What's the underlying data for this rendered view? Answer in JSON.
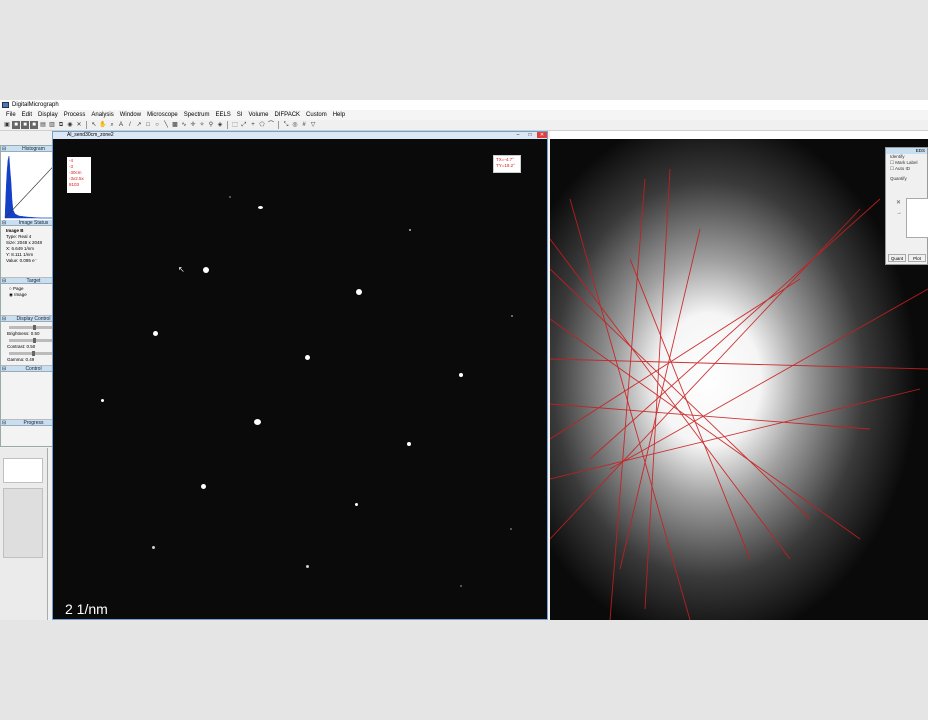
{
  "window": {
    "title": "DigitalMicrograph"
  },
  "menu": [
    "File",
    "Edit",
    "Display",
    "Process",
    "Analysis",
    "Window",
    "Microscope",
    "Spectrum",
    "EELS",
    "SI",
    "Volume",
    "DIFPACK",
    "Custom",
    "Help"
  ],
  "panels": {
    "histogram": "Histogram",
    "image_status": "Image Status",
    "status": {
      "name": "Image B",
      "type": "Type: Real 4",
      "size": "Size: 2048 x 2048",
      "x": "X:   6.649 1/nm",
      "y": "Y:   8.111 1/nm",
      "value": "Value: 0.095 e⁻"
    },
    "target": "Target",
    "target_page": "Page",
    "target_image": "Image",
    "display_control": "Display Control",
    "brightness": "Brightness: 0.50",
    "contrast": "Contrast: 0.50",
    "gamma": "Gamma: 0.49",
    "control": "Control",
    "progress": "Progress"
  },
  "image_window": {
    "title": "Al_send30cm_zone2",
    "scale_label": "2 1/nm",
    "readout": [
      "TX=-4.7°",
      "TY=19.2°"
    ],
    "panel_values": [
      "-4",
      "-3",
      "-30cm",
      "-3x2.5x",
      "8103"
    ]
  },
  "eds_panel": {
    "title": "EDS",
    "identify": "Identify",
    "mark_label": "Mark Label",
    "auto_id": "Auto ID",
    "quantify": "Quantify",
    "quantify_btn": "Quant",
    "plot_btn": "Plot"
  }
}
